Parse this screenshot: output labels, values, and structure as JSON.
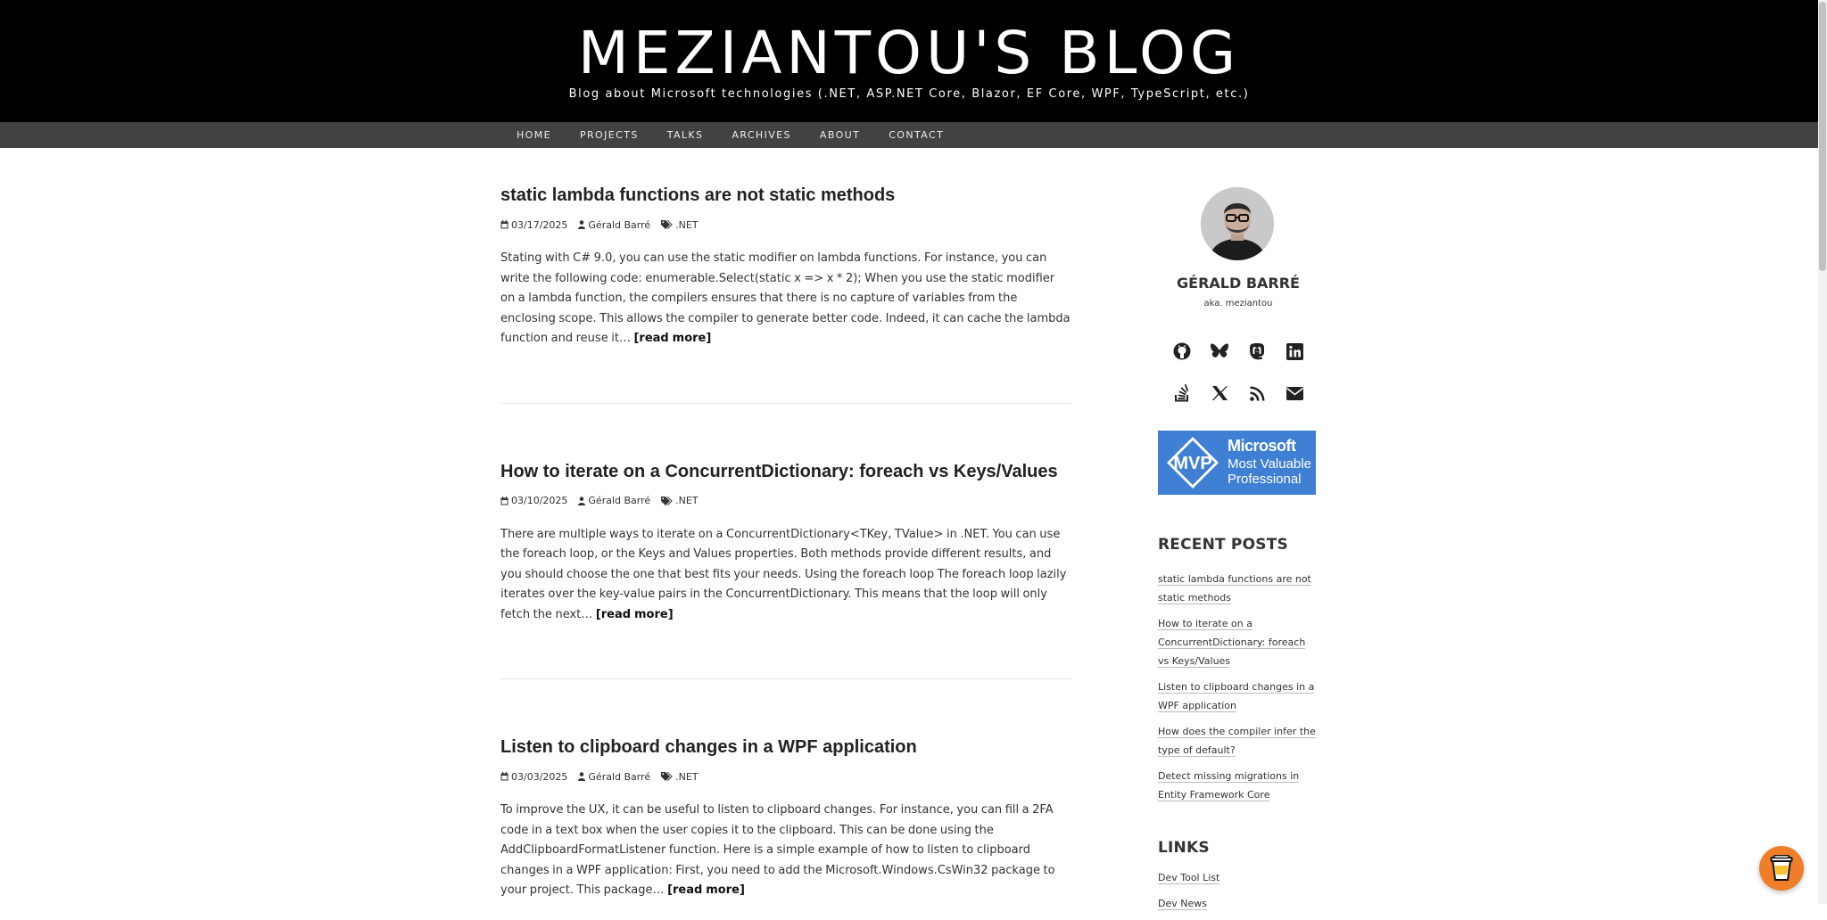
{
  "header": {
    "title": "MEZIANTOU'S BLOG",
    "subtitle": "Blog about Microsoft technologies (.NET, ASP.NET Core, Blazor, EF Core, WPF, TypeScript, etc.)"
  },
  "nav": {
    "items": [
      {
        "label": "HOME"
      },
      {
        "label": "PROJECTS"
      },
      {
        "label": "TALKS"
      },
      {
        "label": "ARCHIVES"
      },
      {
        "label": "ABOUT"
      },
      {
        "label": "CONTACT"
      }
    ]
  },
  "posts": [
    {
      "title": "static lambda functions are not static methods",
      "date": "03/17/2025",
      "author": "Gérald Barré",
      "tag": ".NET",
      "excerpt": "Stating with C# 9.0, you can use the static modifier on lambda functions. For instance, you can write the following code: enumerable.Select(static x => x * 2); When you use the static modifier on a lambda function, the compilers ensures that there is no capture of variables from the enclosing scope. This allows the compiler to generate better code. Indeed, it can cache the lambda function and reuse it…",
      "read_more": "[read more]"
    },
    {
      "title": "How to iterate on a ConcurrentDictionary: foreach vs Keys/Values",
      "date": "03/10/2025",
      "author": "Gérald Barré",
      "tag": ".NET",
      "excerpt": "There are multiple ways to iterate on a ConcurrentDictionary<TKey, TValue> in .NET. You can use the foreach loop, or the Keys and Values properties. Both methods provide different results, and you should choose the one that best fits your needs. Using the foreach loop The foreach loop lazily iterates over the key-value pairs in the ConcurrentDictionary. This means that the loop will only fetch the next…",
      "read_more": "[read more]"
    },
    {
      "title": "Listen to clipboard changes in a WPF application",
      "date": "03/03/2025",
      "author": "Gérald Barré",
      "tag": ".NET",
      "excerpt": "To improve the UX, it can be useful to listen to clipboard changes. For instance, you can fill a 2FA code in a text box when the user copies it to the clipboard. This can be done using the AddClipboardFormatListener function. Here is a simple example of how to listen to clipboard changes in a WPF application: First, you need to add the Microsoft.Windows.CsWin32 package to your project. This package…",
      "read_more": "[read more]"
    }
  ],
  "sidebar": {
    "author_name": "GÉRALD BARRÉ",
    "author_alias": "aka. meziantou",
    "social_row_1": [
      "github-icon",
      "bluesky-icon",
      "mastodon-icon",
      "linkedin-icon"
    ],
    "social_row_2": [
      "stackoverflow-icon",
      "x-icon",
      "rss-icon",
      "email-icon"
    ],
    "mvp": {
      "line1": "Microsoft",
      "line2": "Most Valuable",
      "line3": "Professional",
      "logo_text": "MVP",
      "color": "#3f7fd4"
    },
    "recent_heading": "RECENT POSTS",
    "recent_posts": [
      "static lambda functions are not static methods",
      "How to iterate on a ConcurrentDictionary: foreach vs Keys/Values",
      "Listen to clipboard changes in a WPF application",
      "How does the compiler infer the type of default?",
      "Detect missing migrations in Entity Framework Core"
    ],
    "links_heading": "LINKS",
    "links": [
      "Dev Tool List",
      "Dev News"
    ]
  },
  "floating": {
    "icon": "coffee-cup-icon",
    "color": "#f07d2a"
  }
}
